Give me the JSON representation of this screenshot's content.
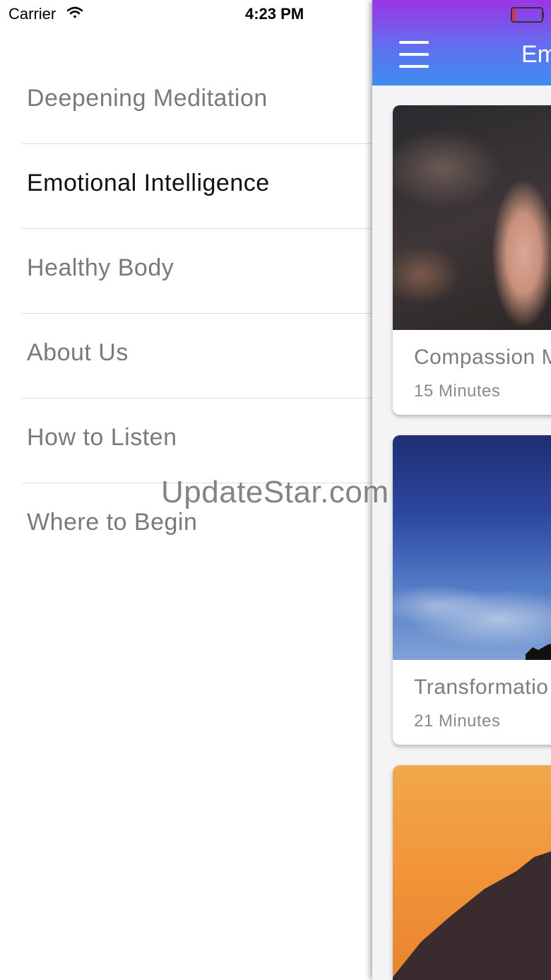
{
  "status_bar": {
    "carrier": "Carrier",
    "time": "4:23 PM"
  },
  "menu": {
    "items": [
      {
        "label": "Deepening Meditation",
        "active": false
      },
      {
        "label": "Emotional Intelligence",
        "active": true
      },
      {
        "label": "Healthy Body",
        "active": false
      },
      {
        "label": "About Us",
        "active": false
      },
      {
        "label": "How to Listen",
        "active": false
      },
      {
        "label": "Where to Begin",
        "active": false
      }
    ]
  },
  "panel": {
    "header_title": "Em",
    "cards": [
      {
        "title": "Compassion M",
        "duration": "15 Minutes",
        "image": "finger-photo"
      },
      {
        "title": "Transformatio",
        "duration": "21 Minutes",
        "image": "sky-photo"
      },
      {
        "title": "",
        "duration": "",
        "image": "sunset-mountain-photo"
      }
    ]
  },
  "watermark": "UpdateStar.com",
  "colors": {
    "header_top": "#9b35e6",
    "header_bottom": "#3f8cf2",
    "active_text": "#111111",
    "inactive_text": "#7a7a7a"
  }
}
